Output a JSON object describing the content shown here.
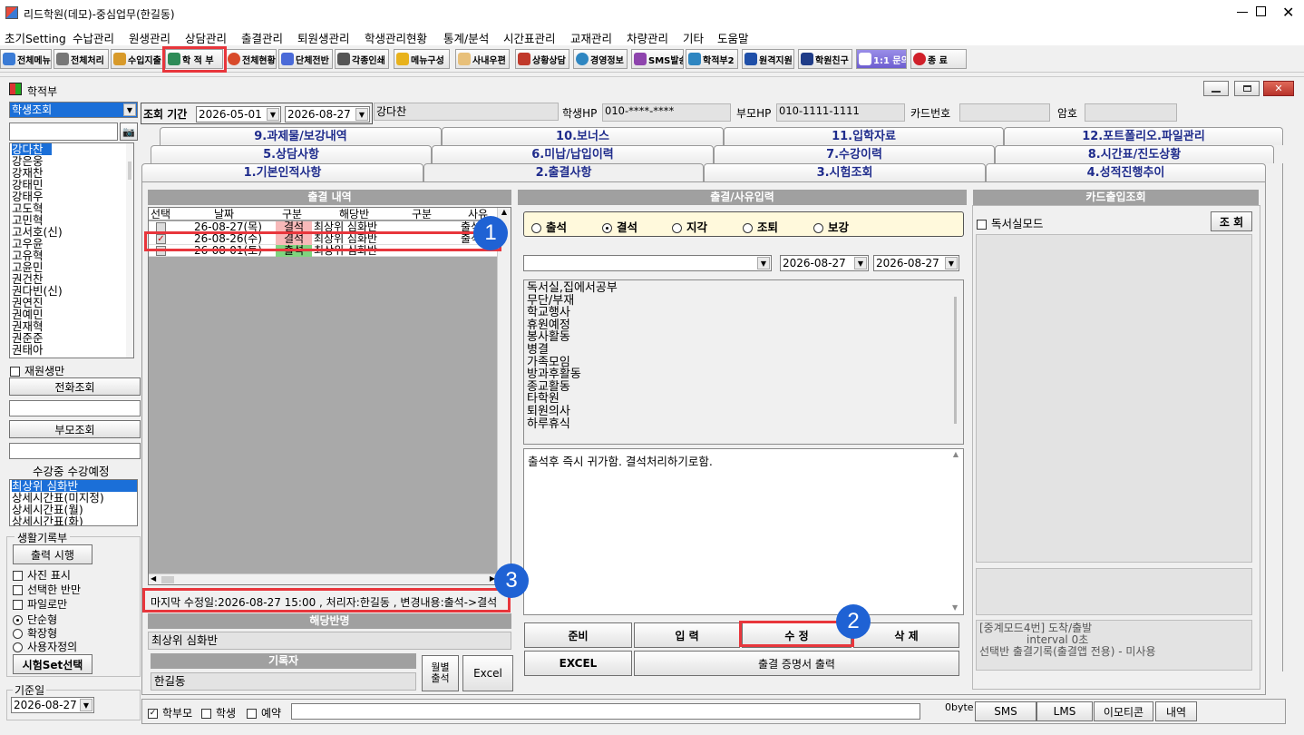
{
  "app": {
    "title": "리드학원(데모)-중심업무(한길동)"
  },
  "menubar": [
    "초기Setting",
    "수납관리",
    "원생관리",
    "상담관리",
    "출결관리",
    "퇴원생관리",
    "학생관리현황",
    "통계/분석",
    "시간표관리",
    "교재관리",
    "차량관리",
    "기타",
    "도움말"
  ],
  "toolbar": [
    {
      "label": "전체메뉴",
      "color": "#3a7bd5"
    },
    {
      "label": "전체처리",
      "color": "#666666"
    },
    {
      "label": "수입지출",
      "color": "#d89a2a"
    },
    {
      "label": "학 적 부",
      "color": "#2e8b57"
    },
    {
      "label": "전체현황",
      "color": "#d84a2a"
    },
    {
      "label": "단체전반",
      "color": "#4a6ad8"
    },
    {
      "label": "각종인쇄",
      "color": "#555555"
    },
    {
      "label": "메뉴구성",
      "color": "#e8b21c"
    },
    {
      "label": "사내우편",
      "color": "#e8c07a"
    },
    {
      "label": "상황상담",
      "color": "#c0392b"
    },
    {
      "label": "경영정보",
      "color": "#2e86c1"
    },
    {
      "label": "SMS발송",
      "color": "#8e44ad"
    },
    {
      "label": "학적부2",
      "color": "#2e86c1"
    },
    {
      "label": "원격지원",
      "color": "#1f4fa8"
    },
    {
      "label": "학원친구",
      "color": "#1f3c88"
    },
    {
      "label": "1:1 문의",
      "color": "#8a7bd8"
    },
    {
      "label": "종  료",
      "color": "#d0202a"
    }
  ],
  "window": {
    "title": "학적부"
  },
  "sidebar": {
    "search_mode": "학생조회",
    "students": [
      "강다찬",
      "강은웅",
      "강재찬",
      "강태민",
      "강태우",
      "고도혁",
      "고민혁",
      "고서호(신)",
      "고우윤",
      "고유혁",
      "고윤민",
      "권건찬",
      "권다빈(신)",
      "권연진",
      "권예민",
      "권재혁",
      "권준준",
      "권태아"
    ],
    "enrolled_only": "재원생만",
    "phone_lookup": "전화조회",
    "parent_lookup": "부모조회",
    "course_header": "수강중 수강예정",
    "courses": [
      "최상위 심화반",
      "상세시간표(미지정)",
      "상세시간표(월)",
      "상세시간표(화)"
    ],
    "record_group": "생활기록부",
    "print_run": "출력 시행",
    "opt_photo": "사진 표시",
    "opt_selected_class": "선택한 반만",
    "opt_file": "파일로만",
    "opt_simple": "단순형",
    "opt_extended": "확장형",
    "opt_custom": "사용자정의",
    "test_set": "시험Set선택",
    "base_date_label": "기준일",
    "base_date": "2026-08-27"
  },
  "header": {
    "period_label": "조회 기간",
    "date_from": "2026-05-01",
    "date_to": "2026-08-27",
    "student_name": "강다찬",
    "student_hp_label": "학생HP",
    "student_hp": "010-****-****",
    "parent_hp_label": "부모HP",
    "parent_hp": "010-1111-1111",
    "card_label": "카드번호",
    "card_value": "",
    "pw_label": "암호",
    "pw_value": ""
  },
  "tabs_row1": [
    "9.과제물/보강내역",
    "10.보너스",
    "11.입학자료",
    "12.포트폴리오.파일관리"
  ],
  "tabs_row2": [
    "5.상담사항",
    "6.미납/납입이력",
    "7.수강이력",
    "8.시간표/진도상황"
  ],
  "tabs_row3": [
    "1.기본인적사항",
    "2.출결사항",
    "3.시험조회",
    "4.성적진행추이"
  ],
  "attendance": {
    "title": "출결 내역",
    "columns": [
      "선택",
      "날짜",
      "구분",
      "해당반",
      "구분",
      "사유"
    ],
    "rows": [
      {
        "date": "26-08-27(목)",
        "type": "결석",
        "class": "최상위 심화반",
        "type2": "",
        "reason": "출석",
        "checked": false
      },
      {
        "date": "26-08-26(수)",
        "type": "결석",
        "class": "최상위 심화반",
        "type2": "",
        "reason": "출석",
        "checked": true
      },
      {
        "date": "26-08-01(토)",
        "type": "출석",
        "class": "최상위 심화반",
        "type2": "",
        "reason": "",
        "checked": false
      }
    ],
    "last_modified": "마지막 수정일:2026-08-27 15:00 , 처리자:한길동 , 변경내용:출석->결석",
    "class_label": "해당반명",
    "class_value": "최상위 심화반",
    "recorder_label": "기록자",
    "recorder_value": "한길동",
    "monthly_btn": "월별 출석",
    "excel_btn": "Excel"
  },
  "reason_input": {
    "title": "출결/사유입력",
    "status_options": [
      "출석",
      "결석",
      "지각",
      "조퇴",
      "보강"
    ],
    "selected_status": "결석",
    "reason_select": "",
    "date1": "2026-08-27",
    "date2": "2026-08-27",
    "reasons": [
      "독서실,집에서공부",
      "무단/부재",
      "학교행사",
      "휴원예정",
      "봉사활동",
      "병결",
      "가족모임",
      "방과후활동",
      "종교활동",
      "타학원",
      "퇴원의사",
      "하루휴식"
    ],
    "memo": "출석후 즉시 귀가함. 결석처리하기로함.",
    "btn_prepare": "준비",
    "btn_input": "입 력",
    "btn_modify": "수 정",
    "btn_delete": "삭 제",
    "btn_excel": "EXCEL",
    "btn_certificate": "출결 증명서 출력"
  },
  "card_panel": {
    "title": "카드출입조회",
    "reading_room_mode": "독서실모드",
    "lookup_btn": "조 회",
    "note1": "[중계모드4번] 도착/출발",
    "note2": "interval 0초",
    "note3": "선택반 출결기록(출결앱 전용) - 미사용"
  },
  "bottom": {
    "opt_parent": "학부모",
    "opt_student": "학생",
    "opt_reserve": "예약",
    "bytes": "0byte",
    "btn_sms": "SMS",
    "btn_lms": "LMS",
    "btn_emoticon": "이모티콘",
    "btn_history": "내역"
  },
  "callouts": [
    "1",
    "2",
    "3"
  ]
}
